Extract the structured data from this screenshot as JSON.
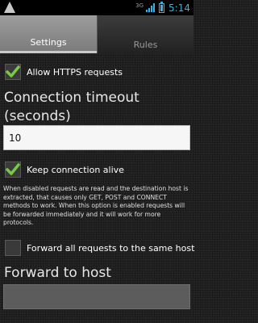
{
  "status_bar": {
    "network": "3G",
    "time": "5:14"
  },
  "tabs": [
    {
      "label": "Settings",
      "selected": true
    },
    {
      "label": "Rules",
      "selected": false
    }
  ],
  "settings": {
    "allow_https": {
      "label": "Allow HTTPS requests",
      "checked": true
    },
    "connection_timeout": {
      "title": "Connection timeout (seconds)",
      "value": "10"
    },
    "keep_alive": {
      "label": "Keep connection alive",
      "checked": true
    },
    "description": "When disabled requests are read and the destination host is extracted, that causes only GET, POST and CONNECT methods to work. When this option is enabled requests will be forwarded immediately and it will work for more protocols.",
    "forward_same_host": {
      "label": "Forward all requests to the same host",
      "checked": false
    },
    "forward_to_host": {
      "title": "Forward to host",
      "value": ""
    }
  },
  "colors": {
    "accent": "#33b5e5",
    "check_green": "#7ac943"
  }
}
